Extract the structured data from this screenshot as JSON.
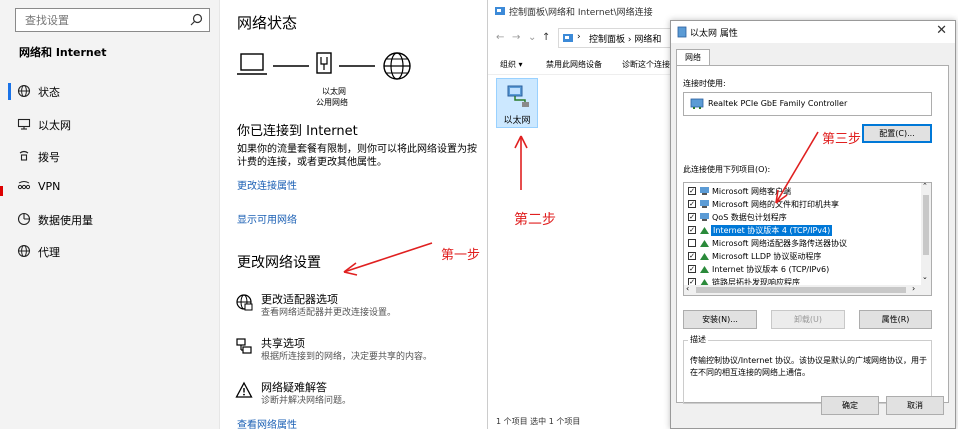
{
  "settings": {
    "search_placeholder": "查找设置",
    "nav_header": "网络和 Internet",
    "nav_items": [
      {
        "label": "状态",
        "icon": "globe-icon"
      },
      {
        "label": "以太网",
        "icon": "monitor-icon"
      },
      {
        "label": "拨号",
        "icon": "phone-icon"
      },
      {
        "label": "VPN",
        "icon": "vpn-icon"
      },
      {
        "label": "数据使用量",
        "icon": "pie-chart-icon"
      },
      {
        "label": "代理",
        "icon": "globe-icon"
      }
    ],
    "page_title": "网络状态",
    "diagram_label_1": "以太网",
    "diagram_label_2": "公用网络",
    "connected_title": "你已连接到 Internet",
    "connected_desc_1": "如果你的流量套餐有限制，则你可以将此网络设置为按",
    "connected_desc_2": "计费的连接，或者更改其他属性。",
    "link_change_props": "更改连接属性",
    "link_show_networks": "显示可用网络",
    "change_title": "更改网络设置",
    "options": [
      {
        "title": "更改适配器选项",
        "desc": "查看网络适配器并更改连接设置。",
        "icon": "network-adapter-icon"
      },
      {
        "title": "共享选项",
        "desc": "根据所连接到的网络，决定要共享的内容。",
        "icon": "share-icon"
      },
      {
        "title": "网络疑难解答",
        "desc": "诊断并解决网络问题。",
        "icon": "warning-icon"
      }
    ],
    "link_view_props": "查看网络属性"
  },
  "netwin": {
    "title": "控制面板\\网络和 Internet\\网络连接",
    "address": "控制面板 › 网络和",
    "commands": [
      "组织 ▾",
      "禁用此网络设备",
      "诊断这个连接"
    ],
    "adapter_label": "以太网",
    "status": "1 个项目    选中 1 个项目"
  },
  "dialog": {
    "title": "以太网 属性",
    "close": "✕",
    "tab": "网络",
    "connect_using_label": "连接时使用:",
    "adapter_name": "Realtek PCIe GbE Family Controller",
    "configure_button": "配置(C)...",
    "items_label": "此连接使用下列项目(O):",
    "items": [
      {
        "label": "Microsoft 网络客户端",
        "checked": true
      },
      {
        "label": "Microsoft 网络的文件和打印机共享",
        "checked": true
      },
      {
        "label": "QoS 数据包计划程序",
        "checked": true
      },
      {
        "label": "Internet 协议版本 4 (TCP/IPv4)",
        "checked": true,
        "selected": true
      },
      {
        "label": "Microsoft 网络适配器多路传送器协议",
        "checked": false
      },
      {
        "label": "Microsoft LLDP 协议驱动程序",
        "checked": true
      },
      {
        "label": "Internet 协议版本 6 (TCP/IPv6)",
        "checked": true
      },
      {
        "label": "链路层拓扑发现响应程序",
        "checked": true
      }
    ],
    "install_button": "安装(N)...",
    "uninstall_button": "卸载(U)",
    "properties_button": "属性(R)",
    "desc_legend": "描述",
    "desc_text": "传输控制协议/Internet 协议。该协议是默认的广域网络协议，用于在不同的相互连接的网络上通信。",
    "ok_button": "确定",
    "cancel_button": "取消"
  },
  "annotations": {
    "step1": "第一步",
    "step2": "第二步",
    "step3": "第三步",
    "color": "#e02020"
  }
}
